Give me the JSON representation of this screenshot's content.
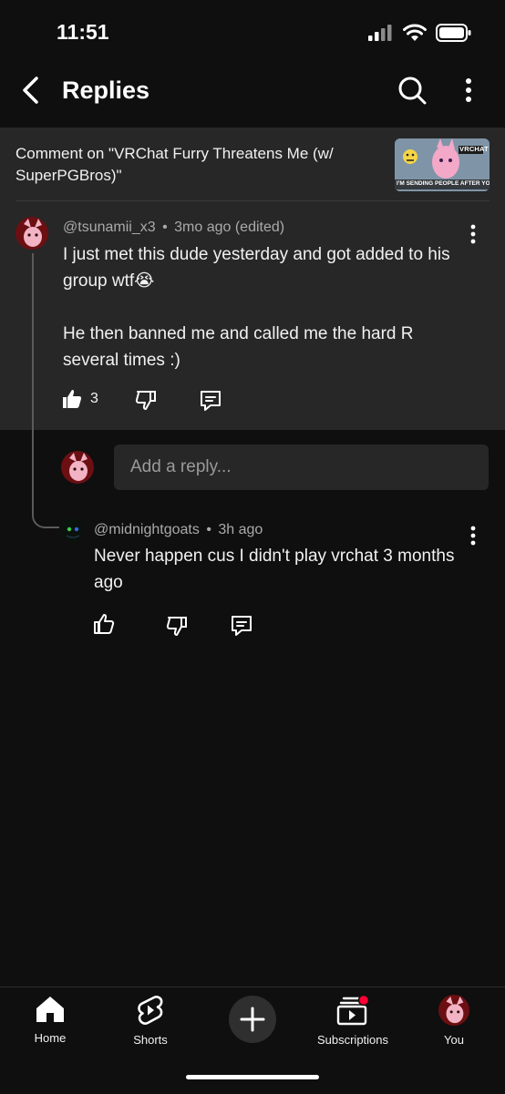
{
  "status_bar": {
    "time": "11:51"
  },
  "header": {
    "title": "Replies"
  },
  "context": {
    "text": "Comment on \"VRChat Furry Threatens Me (w/ SuperPGBros)\"",
    "thumbnail_badge": "VRCHAT",
    "thumbnail_caption": "I'M SENDING PEOPLE AFTER YOU!"
  },
  "main_comment": {
    "author": "@tsunamii_x3",
    "separator": "•",
    "time": "3mo ago (edited)",
    "text": "I just met this dude yesterday and got added to his group wtf😭\n\nHe then banned me and called me the hard R several times :)",
    "likes": "3"
  },
  "reply_box": {
    "placeholder": "Add a reply..."
  },
  "reply": {
    "author": "@midnightgoats",
    "separator": "•",
    "time": "3h ago",
    "text": "Never happen cus I didn't play vrchat 3 months ago"
  },
  "bottom_nav": [
    {
      "label": "Home",
      "icon": "home-icon"
    },
    {
      "label": "Shorts",
      "icon": "shorts-icon"
    },
    {
      "label": "",
      "icon": "create-icon"
    },
    {
      "label": "Subscriptions",
      "icon": "subscriptions-icon"
    },
    {
      "label": "You",
      "icon": "avatar"
    }
  ],
  "colors": {
    "background": "#0f0f0f",
    "surface": "#272727",
    "notification": "#ff0033"
  }
}
